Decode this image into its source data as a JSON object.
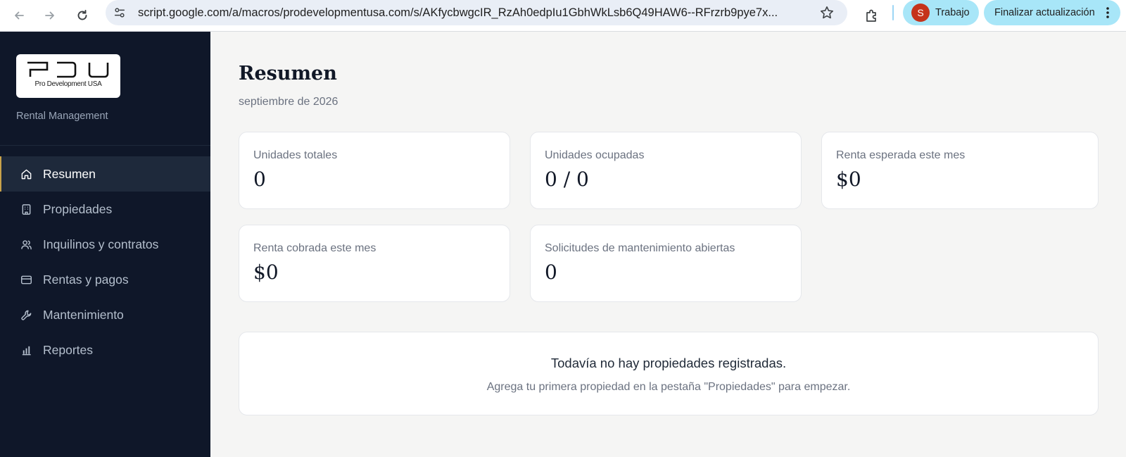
{
  "browser": {
    "url": "script.google.com/a/macros/prodevelopmentusa.com/s/AKfycbwgcIR_RzAh0edpIu1GbhWkLsb6Q49HAW6--RFrzrb9pye7x...",
    "profile_initial": "S",
    "profile_label": "Trabajo",
    "update_label": "Finalizar actualización"
  },
  "sidebar": {
    "logo_mark": "PDU",
    "logo_text": "Pro Development USA",
    "tagline": "Rental Management",
    "items": [
      {
        "label": "Resumen",
        "icon": "home-icon",
        "active": true
      },
      {
        "label": "Propiedades",
        "icon": "building-icon",
        "active": false
      },
      {
        "label": "Inquilinos y contratos",
        "icon": "users-icon",
        "active": false
      },
      {
        "label": "Rentas y pagos",
        "icon": "credit-card-icon",
        "active": false
      },
      {
        "label": "Mantenimiento",
        "icon": "wrench-icon",
        "active": false
      },
      {
        "label": "Reportes",
        "icon": "bar-chart-icon",
        "active": false
      }
    ]
  },
  "main": {
    "title": "Resumen",
    "subtitle": "septiembre de 2026",
    "stats": [
      {
        "label": "Unidades totales",
        "value": "0"
      },
      {
        "label": "Unidades ocupadas",
        "value": "0 / 0"
      },
      {
        "label": "Renta esperada este mes",
        "value": "$0"
      },
      {
        "label": "Renta cobrada este mes",
        "value": "$0"
      },
      {
        "label": "Solicitudes de mantenimiento abiertas",
        "value": "0"
      }
    ],
    "empty_state": {
      "title": "Todavía no hay propiedades registradas.",
      "message": "Agrega tu primera propiedad en la pestaña \"Propiedades\" para empezar."
    }
  },
  "colors": {
    "sidebar_bg": "#0f1729",
    "sidebar_active_bg": "#1e293b",
    "accent_gold": "#c9a24a",
    "page_bg": "#f5f5f4",
    "profile_pill": "#a8e6f8",
    "avatar": "#c5331b"
  }
}
